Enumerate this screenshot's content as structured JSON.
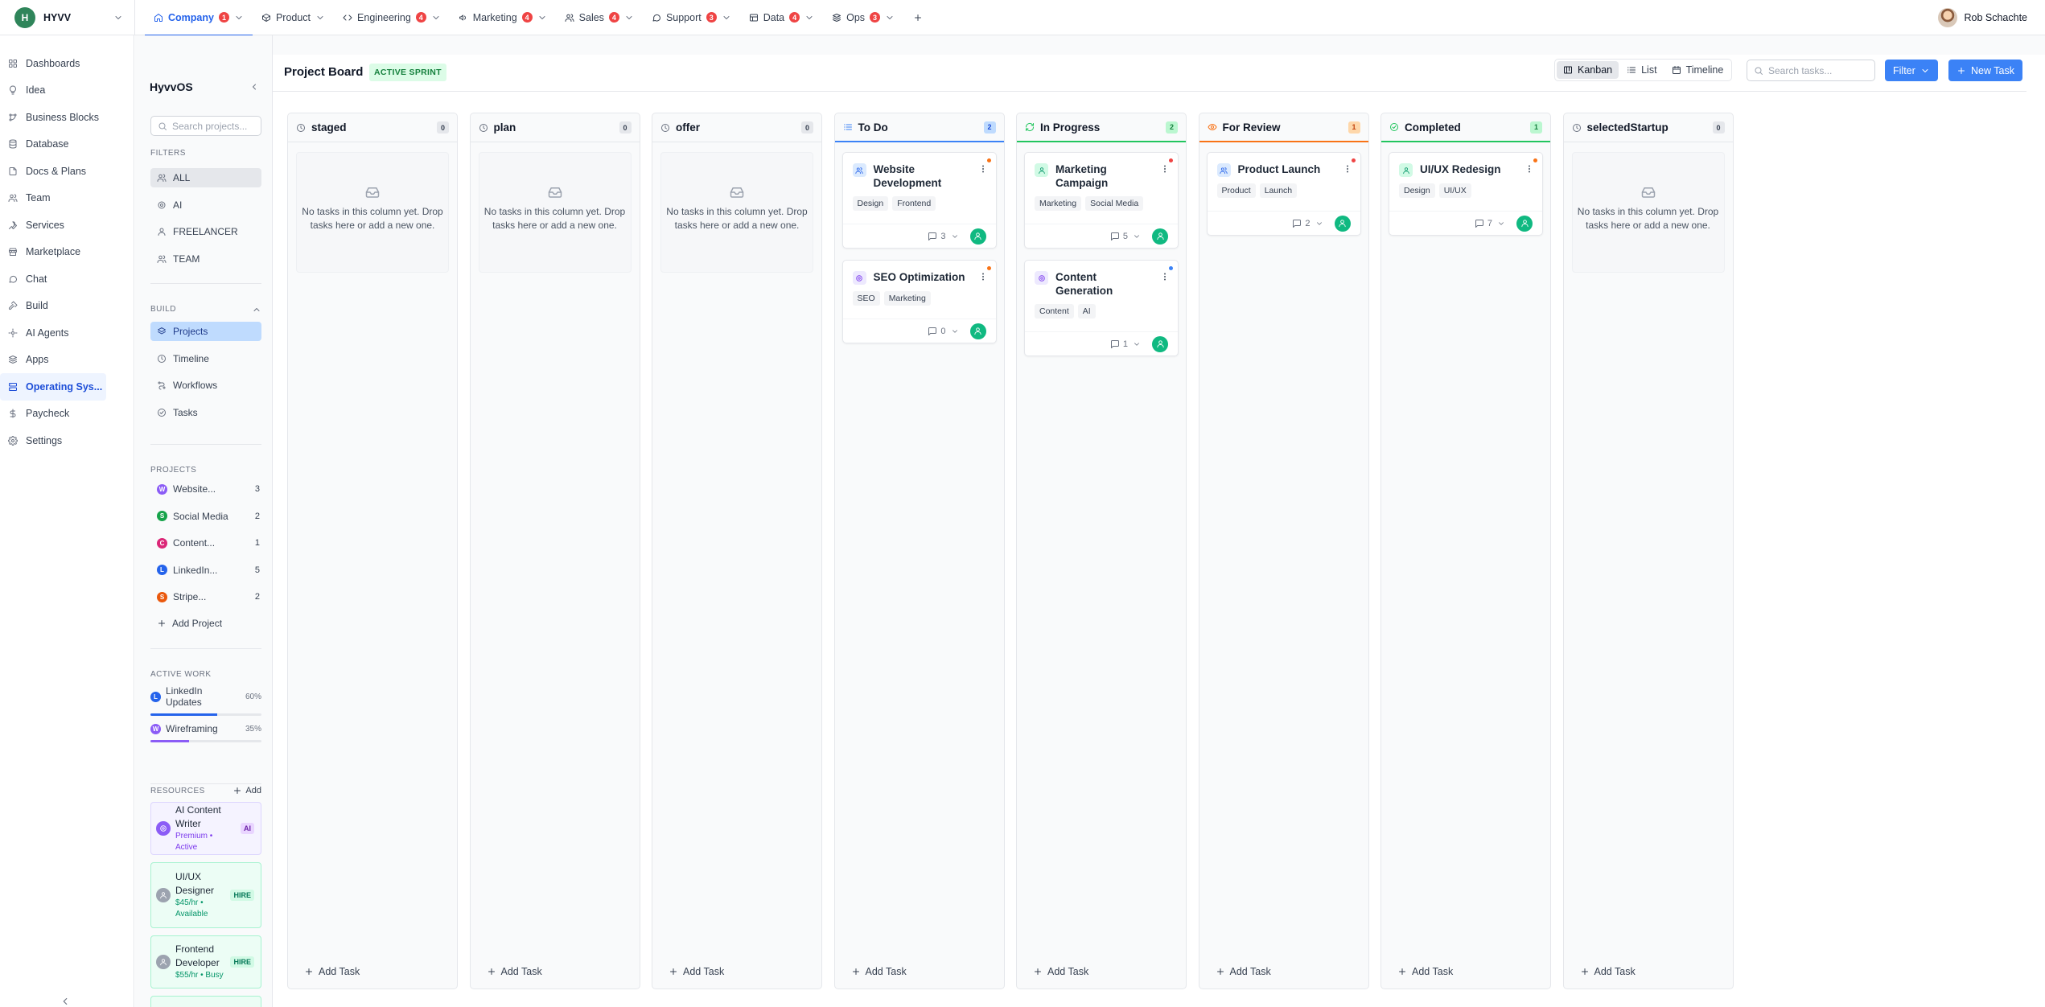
{
  "workspace": {
    "initial": "H",
    "name": "HYVV"
  },
  "tabs": [
    {
      "label": "Company",
      "badge": "1"
    },
    {
      "label": "Product",
      "badge": ""
    },
    {
      "label": "Engineering",
      "badge": "4"
    },
    {
      "label": "Marketing",
      "badge": "4"
    },
    {
      "label": "Sales",
      "badge": "4"
    },
    {
      "label": "Support",
      "badge": "3"
    },
    {
      "label": "Data",
      "badge": "4"
    },
    {
      "label": "Ops",
      "badge": "3"
    }
  ],
  "user": {
    "name": "Rob Schachte"
  },
  "nav": [
    {
      "label": "Dashboards",
      "icon": "grid-icon"
    },
    {
      "label": "Idea",
      "icon": "lightbulb-icon"
    },
    {
      "label": "Business Blocks",
      "icon": "blocks-icon"
    },
    {
      "label": "Database",
      "icon": "database-icon"
    },
    {
      "label": "Docs & Plans",
      "icon": "docs-icon"
    },
    {
      "label": "Team",
      "icon": "team-icon"
    },
    {
      "label": "Services",
      "icon": "wrench-icon"
    },
    {
      "label": "Marketplace",
      "icon": "store-icon"
    },
    {
      "label": "Chat",
      "icon": "chat-icon"
    },
    {
      "label": "Build",
      "icon": "hammer-icon"
    },
    {
      "label": "AI Agents",
      "icon": "bot-icon"
    },
    {
      "label": "Apps",
      "icon": "apps-icon"
    },
    {
      "label": "Operating Sys...",
      "icon": "server-icon"
    },
    {
      "label": "Paycheck",
      "icon": "dollar-icon"
    },
    {
      "label": "Settings",
      "icon": "gear-icon"
    }
  ],
  "sidebar": {
    "title": "HyvvOS",
    "search_placeholder": "Search projects...",
    "filters_label": "FILTERS",
    "filters": [
      "ALL",
      "AI",
      "FREELANCER",
      "TEAM"
    ],
    "build_label": "BUILD",
    "build": [
      "Projects",
      "Timeline",
      "Workflows",
      "Tasks"
    ],
    "projects_label": "PROJECTS",
    "projects": [
      {
        "initial": "W",
        "name": "Website...",
        "count": "3",
        "color": "#8b5cf6"
      },
      {
        "initial": "S",
        "name": "Social Media",
        "count": "2",
        "color": "#16a34a"
      },
      {
        "initial": "C",
        "name": "Content...",
        "count": "1",
        "color": "#db2777"
      },
      {
        "initial": "L",
        "name": "LinkedIn...",
        "count": "5",
        "color": "#2563eb"
      },
      {
        "initial": "S",
        "name": "Stripe...",
        "count": "2",
        "color": "#ea580c"
      }
    ],
    "add_project": "Add Project",
    "active_work_label": "ACTIVE WORK",
    "active_work": [
      {
        "initial": "L",
        "name": "LinkedIn Updates",
        "percent": "60%",
        "value": 60,
        "color": "#2563eb"
      },
      {
        "initial": "W",
        "name": "Wireframing",
        "percent": "35%",
        "value": 35,
        "color": "#8b5cf6"
      }
    ],
    "resources_label": "RESOURCES",
    "resources_add": "Add",
    "resources": [
      {
        "name": "AI Content Writer",
        "sub": "Premium • Active",
        "tag": "AI"
      },
      {
        "name": "UI/UX Designer",
        "sub": "$45/hr • Available",
        "tag": "HIRE"
      },
      {
        "name": "Frontend Developer",
        "sub": "$55/hr • Busy",
        "tag": "HIRE"
      }
    ]
  },
  "header": {
    "title": "Project Board",
    "badge": "ACTIVE SPRINT",
    "views": [
      "Kanban",
      "List",
      "Timeline"
    ],
    "search_placeholder": "Search tasks...",
    "filter": "Filter",
    "new_task": "New Task"
  },
  "board": {
    "empty_text": "No tasks in this column yet. Drop tasks here or add a new one.",
    "add_task": "Add Task",
    "columns": [
      {
        "title": "staged",
        "count": "0",
        "icon": "clock-icon",
        "accent": ""
      },
      {
        "title": "plan",
        "count": "0",
        "icon": "clock-icon",
        "accent": ""
      },
      {
        "title": "offer",
        "count": "0",
        "icon": "clock-icon",
        "accent": ""
      },
      {
        "title": "To Do",
        "count": "2",
        "icon": "list-icon",
        "accent": "#3b82f6"
      },
      {
        "title": "In Progress",
        "count": "2",
        "icon": "refresh-icon",
        "accent": "#22c55e"
      },
      {
        "title": "For Review",
        "count": "1",
        "icon": "eye-icon",
        "accent": "#f97316"
      },
      {
        "title": "Completed",
        "count": "1",
        "icon": "check-circle-icon",
        "accent": "#22c55e"
      },
      {
        "title": "selectedStartup",
        "count": "0",
        "icon": "clock-icon",
        "accent": ""
      }
    ],
    "cards": [
      [],
      [],
      [],
      [
        {
          "title": "Website Development",
          "tags": [
            "Design",
            "Frontend"
          ],
          "comments": "3",
          "icon": "team-icon",
          "dot": "#f97316"
        },
        {
          "title": "SEO Optimization",
          "tags": [
            "SEO",
            "Marketing"
          ],
          "comments": "0",
          "icon": "ai-icon",
          "dot": "#f97316"
        }
      ],
      [
        {
          "title": "Marketing Campaign",
          "tags": [
            "Marketing",
            "Social Media"
          ],
          "comments": "5",
          "icon": "user-icon",
          "dot": "#ef4444"
        },
        {
          "title": "Content Generation",
          "tags": [
            "Content",
            "AI"
          ],
          "comments": "1",
          "icon": "ai-icon",
          "dot": "#3b82f6"
        }
      ],
      [
        {
          "title": "Product Launch",
          "tags": [
            "Product",
            "Launch"
          ],
          "comments": "2",
          "icon": "team-icon",
          "dot": "#ef4444"
        }
      ],
      [
        {
          "title": "UI/UX Redesign",
          "tags": [
            "Design",
            "UI/UX"
          ],
          "comments": "7",
          "icon": "user-icon",
          "dot": "#f97316"
        }
      ],
      []
    ]
  }
}
